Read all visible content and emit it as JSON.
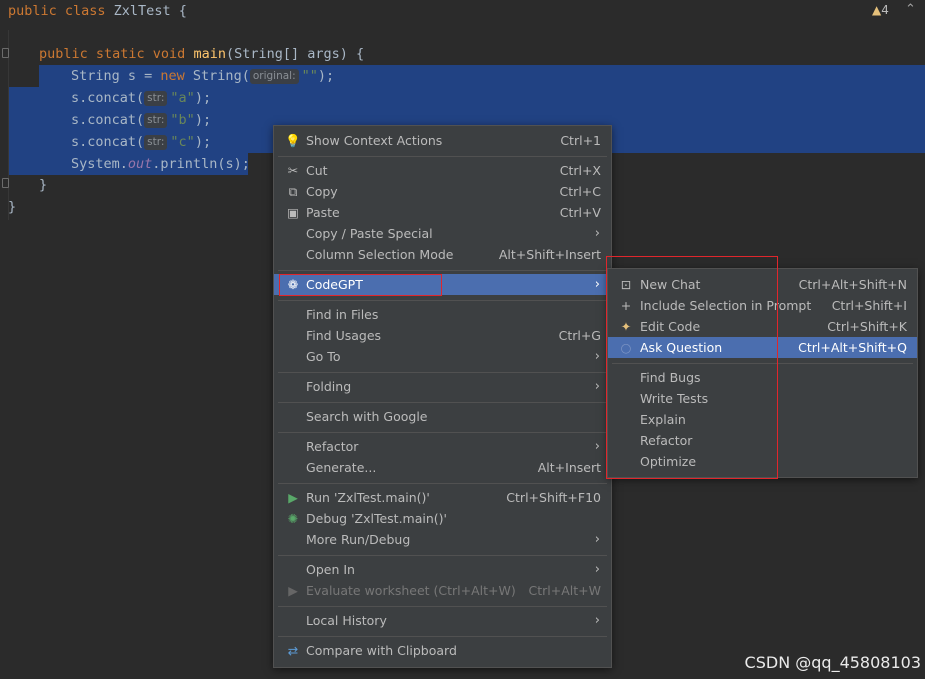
{
  "editor": {
    "line1": {
      "kw": "public class",
      "name": " ZxlTest {"
    },
    "line3": {
      "kw": "public static void",
      "fn": "main",
      "rest": "(String[] args) {"
    },
    "line4": {
      "pre": "String s = ",
      "kw": "new",
      "call": " String(",
      "hint": "original:",
      "str": "\"\"",
      "end": ");"
    },
    "line5": {
      "pre": "s.concat(",
      "hint": "str:",
      "str": "\"a\"",
      "end": ");"
    },
    "line6": {
      "pre": "s.concat(",
      "hint": "str:",
      "str": "\"b\"",
      "end": ");"
    },
    "line7": {
      "pre": "s.concat(",
      "hint": "str:",
      "str": "\"c\"",
      "end": ");"
    },
    "line8": {
      "pre": "System.",
      "fld": "out",
      "rest": ".println(s);"
    },
    "line9": "}",
    "line10": "}"
  },
  "status": {
    "warnings": "4",
    "warning_icon": "warning-triangle-icon"
  },
  "context_menu": {
    "items": [
      {
        "label": "Show Context Actions",
        "shortcut": "Ctrl+1",
        "icon": "lightbulb-icon"
      },
      {
        "label": "Cut",
        "shortcut": "Ctrl+X",
        "icon": "scissors-icon"
      },
      {
        "label": "Copy",
        "shortcut": "Ctrl+C",
        "icon": "copy-icon"
      },
      {
        "label": "Paste",
        "shortcut": "Ctrl+V",
        "icon": "clipboard-icon"
      },
      {
        "label": "Copy / Paste Special",
        "shortcut": ""
      },
      {
        "label": "Column Selection Mode",
        "shortcut": "Alt+Shift+Insert"
      },
      {
        "label": "CodeGPT",
        "shortcut": "",
        "icon": "openai-icon"
      },
      {
        "label": "Find in Files",
        "shortcut": ""
      },
      {
        "label": "Find Usages",
        "shortcut": "Ctrl+G"
      },
      {
        "label": "Go To",
        "shortcut": ""
      },
      {
        "label": "Folding",
        "shortcut": ""
      },
      {
        "label": "Search with Google",
        "shortcut": ""
      },
      {
        "label": "Refactor",
        "shortcut": ""
      },
      {
        "label": "Generate...",
        "shortcut": "Alt+Insert"
      },
      {
        "label": "Run 'ZxlTest.main()'",
        "shortcut": "Ctrl+Shift+F10",
        "icon": "run-icon"
      },
      {
        "label": "Debug 'ZxlTest.main()'",
        "shortcut": "",
        "icon": "debug-icon"
      },
      {
        "label": "More Run/Debug",
        "shortcut": ""
      },
      {
        "label": "Open In",
        "shortcut": ""
      },
      {
        "label": "Evaluate worksheet (Ctrl+Alt+W)",
        "shortcut": "Ctrl+Alt+W"
      },
      {
        "label": "Local History",
        "shortcut": ""
      },
      {
        "label": "Compare with Clipboard",
        "shortcut": "",
        "icon": "compare-icon"
      }
    ]
  },
  "codegpt_submenu": {
    "items": [
      {
        "label": "New Chat",
        "shortcut": "Ctrl+Alt+Shift+N",
        "icon": "new-chat-icon"
      },
      {
        "label": "Include Selection in Prompt",
        "shortcut": "Ctrl+Shift+I",
        "icon": "plus-icon"
      },
      {
        "label": "Edit Code",
        "shortcut": "Ctrl+Shift+K",
        "icon": "sparkle-icon"
      },
      {
        "label": "Ask Question",
        "shortcut": "Ctrl+Alt+Shift+Q",
        "icon": "question-icon"
      },
      {
        "label": "Find Bugs",
        "shortcut": ""
      },
      {
        "label": "Write Tests",
        "shortcut": ""
      },
      {
        "label": "Explain",
        "shortcut": ""
      },
      {
        "label": "Refactor",
        "shortcut": ""
      },
      {
        "label": "Optimize",
        "shortcut": ""
      }
    ]
  },
  "watermark": "CSDN @qq_45808103",
  "colors": {
    "menu_bg": "#3c3f41",
    "highlight": "#4b6eaf",
    "selection": "#214283",
    "annotation": "#e0262c"
  }
}
